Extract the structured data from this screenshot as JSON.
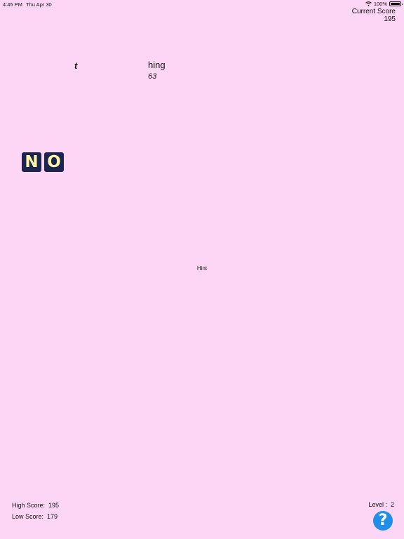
{
  "status_bar": {
    "time": "4:45 PM",
    "date": "Thu Apr 30",
    "battery": "100%",
    "wifi_icon": "wifi-icon",
    "battery_icon": "battery-icon"
  },
  "current_score": {
    "label": "Current Score",
    "value": "195"
  },
  "word": {
    "left_fragment": "t",
    "right_fragment": "hing",
    "number": "63"
  },
  "tiles": {
    "letters": [
      "N",
      "O"
    ],
    "tile_color": "#1c2550",
    "letter_color": "#fcf6a6"
  },
  "hint": {
    "label": "Hint"
  },
  "footer": {
    "high_score_label": "High Score:",
    "high_score_value": "195",
    "low_score_label": "Low Score:",
    "low_score_value": "179",
    "level_label": "Level :",
    "level_value": "2",
    "help_label": "?",
    "help_icon": "question-mark-icon",
    "help_color": "#1f8fe8"
  },
  "colors": {
    "background": "#fdd6f5"
  }
}
